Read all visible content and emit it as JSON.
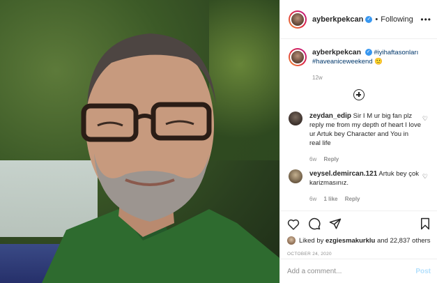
{
  "post": {
    "username": "ayberkpekcan",
    "verified_mark": "✓",
    "separator": "•",
    "follow_label": "Following",
    "more_label": "•••"
  },
  "caption": {
    "username": "ayberkpekcan",
    "hashtags": "#iyihaftasonları #haveaniceweekend",
    "emoji": "🙂",
    "age": "12w"
  },
  "comments": [
    {
      "username": "zeydan_edip",
      "text": "Sir I M ur big fan plz reply me from my depth of heart I love ur Artuk bey Character and You in real life",
      "age": "6w",
      "likes": "",
      "reply_label": "Reply"
    },
    {
      "username": "veysel.demircan.121",
      "text": "Artuk bey çok karizmasınız.",
      "age": "6w",
      "likes": "1 like",
      "reply_label": "Reply"
    }
  ],
  "likes": {
    "prefix": "Liked by",
    "user": "ezgiesmakurklu",
    "suffix": "and 22,837 others"
  },
  "date": "OCTOBER 24, 2020",
  "add_comment": {
    "placeholder": "Add a comment...",
    "post_label": "Post"
  },
  "colors": {
    "link": "#00376b",
    "verified": "#3897f0",
    "post_disabled": "#b2dffc"
  },
  "icons": [
    "heart-icon",
    "comment-icon",
    "share-icon",
    "bookmark-icon",
    "more-icon",
    "add-circle-icon"
  ]
}
